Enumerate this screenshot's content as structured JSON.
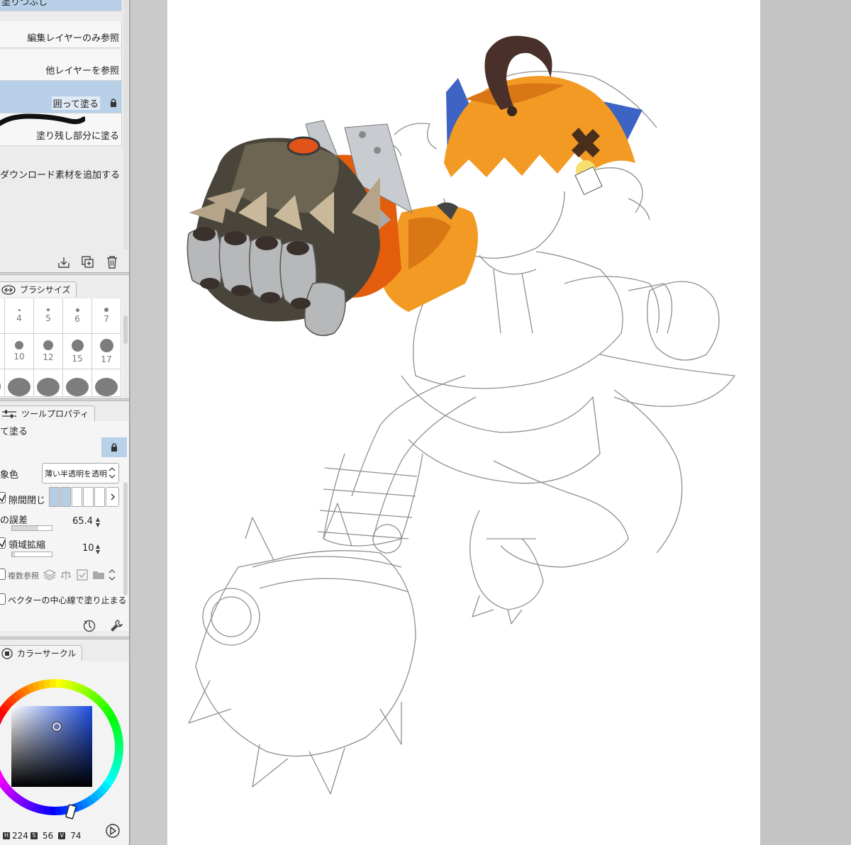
{
  "subtool": {
    "items": [
      {
        "label": "塗りつぶし",
        "selected": true
      },
      {
        "label": "編集レイヤーのみ参照",
        "selected": false
      },
      {
        "label": "他レイヤーを参照",
        "selected": false
      },
      {
        "label": "囲って塗る",
        "selected": true,
        "locked": true
      },
      {
        "label": "塗り残し部分に塗る",
        "selected": false
      }
    ],
    "add_material": "ダウンロード素材を追加する",
    "actions": [
      "download-icon",
      "duplicate-icon",
      "trash-icon"
    ]
  },
  "brush_size": {
    "tab_label": "ブラシサイズ",
    "sizes": [
      "4",
      "5",
      "6",
      "7",
      "10",
      "12",
      "15",
      "17"
    ]
  },
  "tool_property": {
    "tab_label": "ツールプロパティ",
    "tool_name": "て塗る",
    "target_label": "象色",
    "target_value": "薄い半透明を透明",
    "gap_close_label": "隙間閉じ",
    "tolerance_label": "の誤差",
    "tolerance_value": "65.4",
    "tolerance_level": 0.654,
    "area_scale_label": "領域拡縮",
    "area_scale_value": "10",
    "multi_ref_label": "複数参照",
    "vector_stop_label": "ベクターの中心線で塗り止まる"
  },
  "color_circle": {
    "tab_label": "カラーサークル",
    "h_key": "H",
    "h_value": "224",
    "s_key": "S",
    "s_value": "56",
    "v_key": "V",
    "v_value": "74",
    "hue_color": "#1f4fe0"
  },
  "colors": {
    "selection": "#b9d1e8",
    "orange": "#f29a23",
    "blue_ear": "#3d63c4"
  }
}
